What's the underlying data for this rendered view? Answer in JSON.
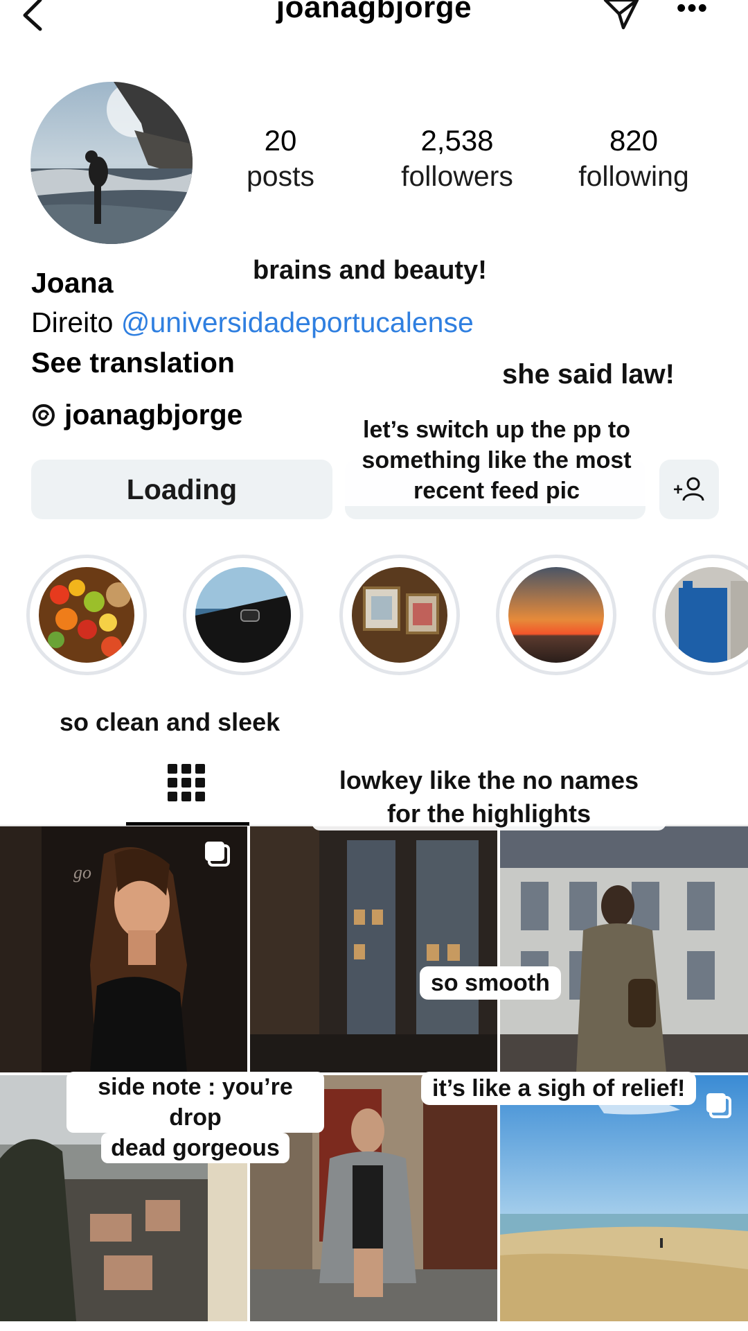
{
  "header": {
    "username": "joanagbjorge"
  },
  "profile": {
    "stats": [
      {
        "value": "20",
        "label": "posts"
      },
      {
        "value": "2,538",
        "label": "followers"
      },
      {
        "value": "820",
        "label": "following"
      }
    ],
    "name": "Joana",
    "bio_prefix": "Direito ",
    "bio_link": "@universidadeportucalense",
    "see_translation": "See translation",
    "threads_handle": "joanagbjorge"
  },
  "buttons": {
    "primary_label": "Loading"
  },
  "captions": {
    "brains": "brains and beauty!",
    "law": "she said law!",
    "pp_line1": "let’s switch up the pp to",
    "pp_line2": "something like the most",
    "pp_line3": "recent feed pic",
    "clean": "so clean and sleek",
    "lowkey_line1": "lowkey like the no names",
    "lowkey_line2": "for the highlights",
    "smooth": "so smooth",
    "side_line1": "side note : you’re drop",
    "side_line2": "dead gorgeous",
    "relief": "it’s like a sigh of relief!"
  },
  "highlights_count": 5,
  "colors": {
    "link": "#2f7fe0",
    "button_bg": "#eef2f4",
    "ring": "#e2e5ea"
  },
  "icons": [
    "back-chevron-icon",
    "send-icon",
    "more-icon",
    "threads-icon",
    "add-person-icon",
    "grid-icon",
    "multiple-posts-icon"
  ]
}
